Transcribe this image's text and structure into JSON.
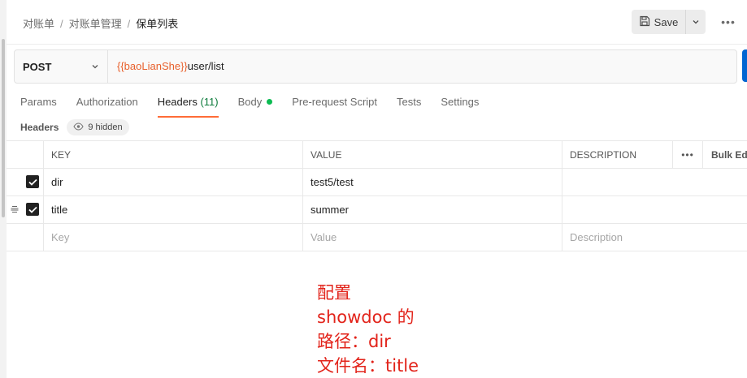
{
  "breadcrumb": {
    "items": [
      "对账单",
      "对账单管理"
    ],
    "separator": "/",
    "current": "保单列表"
  },
  "toolbar": {
    "save_label": "Save",
    "more_label": "•••"
  },
  "request": {
    "method": "POST",
    "url_variable": "{{baoLianShe}}",
    "url_path": "user/list"
  },
  "tabs": [
    {
      "label": "Params"
    },
    {
      "label": "Authorization"
    },
    {
      "label": "Headers",
      "count": "(11)",
      "active": true
    },
    {
      "label": "Body",
      "dot_color": "#0cbb52"
    },
    {
      "label": "Pre-request Script"
    },
    {
      "label": "Tests"
    },
    {
      "label": "Settings"
    }
  ],
  "headers_section": {
    "label": "Headers",
    "hidden_label": "9 hidden"
  },
  "table": {
    "columns": {
      "key": "KEY",
      "value": "VALUE",
      "description": "DESCRIPTION",
      "more": "•••",
      "bulk_edit": "Bulk Ed"
    },
    "rows": [
      {
        "key": "dir",
        "value": "test5/test",
        "description": "",
        "checked": true
      },
      {
        "key": "title",
        "value": "summer",
        "description": "",
        "checked": true
      }
    ],
    "placeholders": {
      "key": "Key",
      "value": "Value",
      "description": "Description"
    }
  },
  "annotation": {
    "lines": [
      "配置",
      "showdoc 的",
      "路径：dir",
      "文件名：title"
    ],
    "color": "#e2231a"
  },
  "colors": {
    "accent": "#ff6c37",
    "send": "#0265d2",
    "variable": "#e8602c"
  }
}
